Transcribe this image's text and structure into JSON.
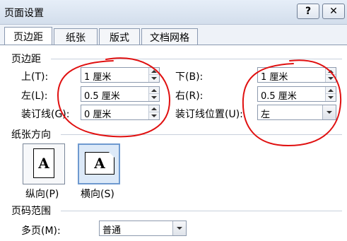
{
  "window": {
    "title": "页面设置",
    "help_label": "?",
    "close_label": "✕"
  },
  "tabs": [
    {
      "label": "页边距",
      "active": true
    },
    {
      "label": "纸张",
      "active": false
    },
    {
      "label": "版式",
      "active": false
    },
    {
      "label": "文档网格",
      "active": false
    }
  ],
  "margins": {
    "section_label": "页边距",
    "top": {
      "label": "上(T):",
      "value": "1 厘米"
    },
    "bottom": {
      "label": "下(B):",
      "value": "1 厘米"
    },
    "left": {
      "label": "左(L):",
      "value": "0.5 厘米"
    },
    "right": {
      "label": "右(R):",
      "value": "0.5 厘米"
    },
    "gutter": {
      "label": "装订线(G):",
      "value": "0 厘米"
    },
    "gutter_position": {
      "label": "装订线位置(U):",
      "value": "左"
    }
  },
  "orientation": {
    "section_label": "纸张方向",
    "glyph": "A",
    "portrait_label": "纵向(P)",
    "landscape_label": "横向(S)",
    "selected": "landscape"
  },
  "pages": {
    "section_label": "页码范围",
    "multiple_label": "多页(M):",
    "multiple_value": "普通"
  },
  "annotation": {
    "ink_color": "#e01010"
  }
}
